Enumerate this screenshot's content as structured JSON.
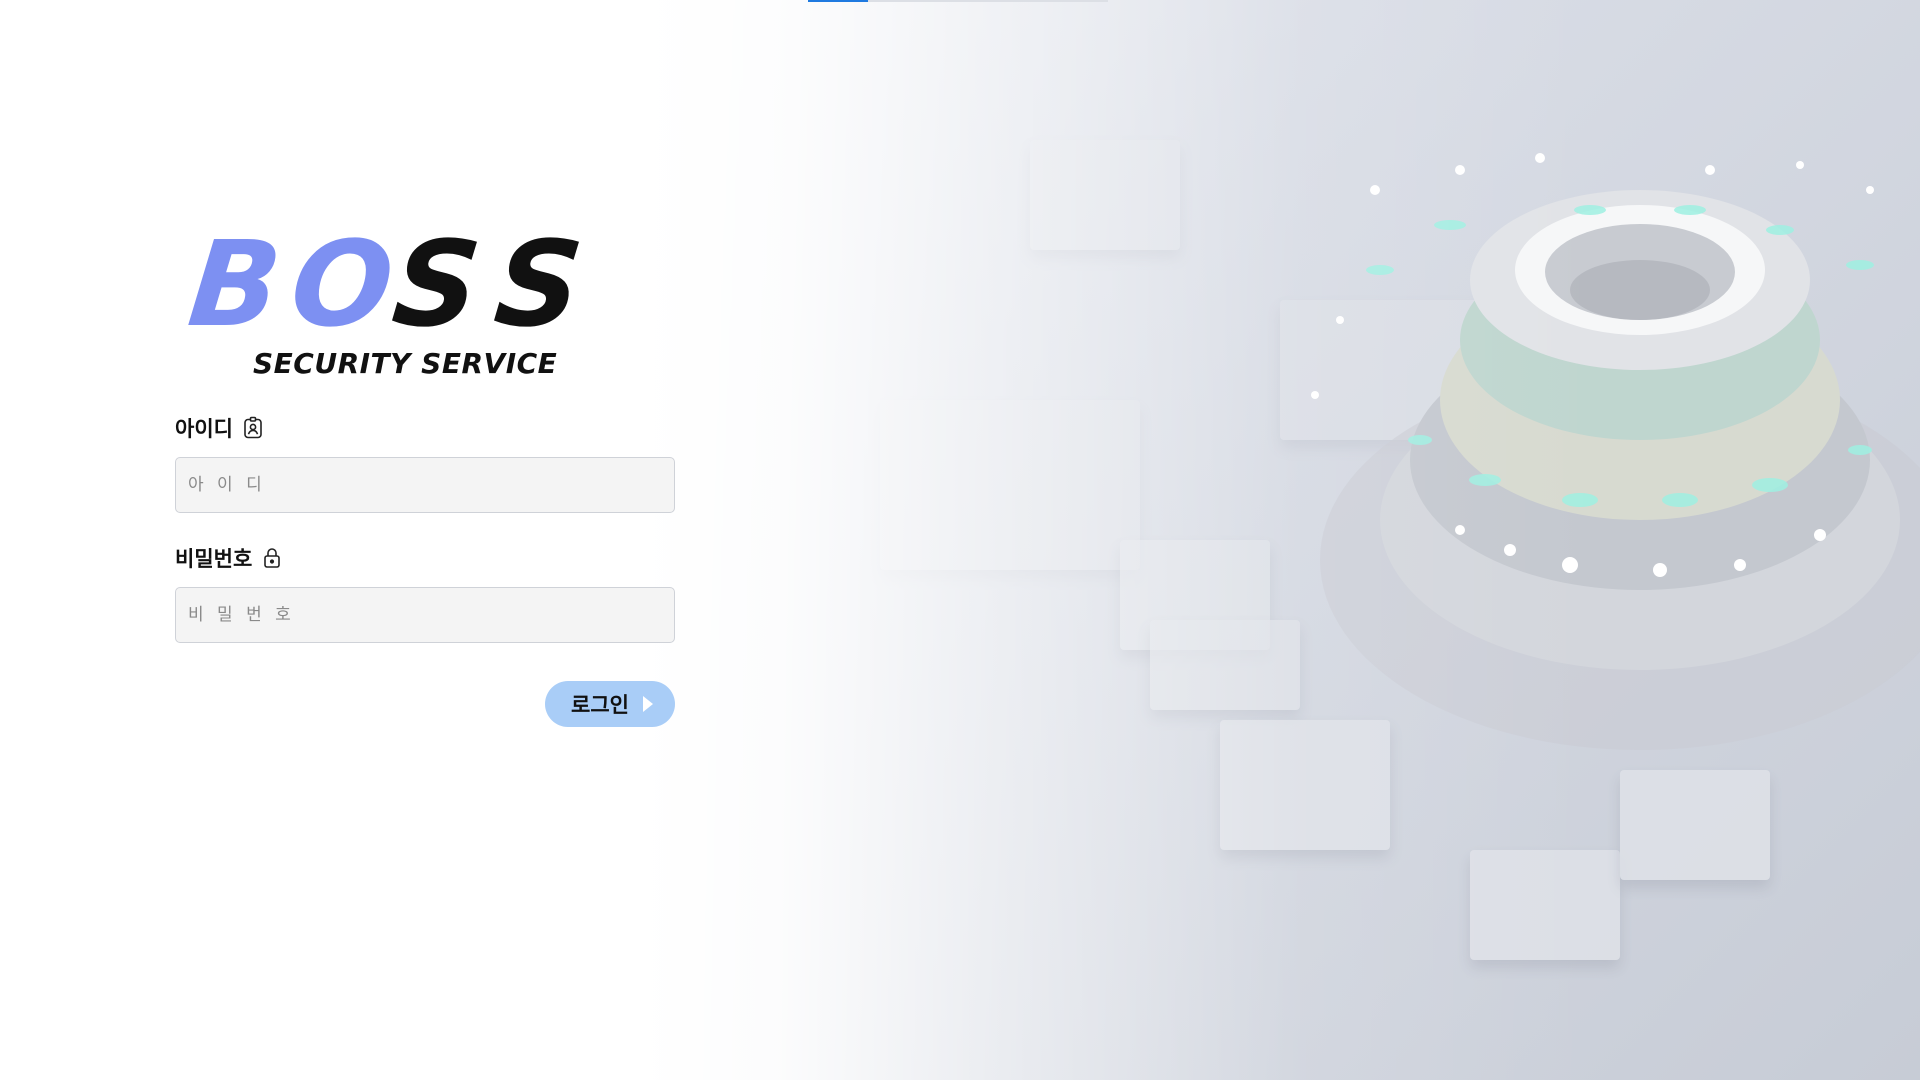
{
  "logo": {
    "letters": [
      "B",
      "O",
      "S",
      "S"
    ],
    "subtitle": "SECURITY SERVICE",
    "colors": {
      "accent": "#7d90f2",
      "dark": "#111111"
    }
  },
  "form": {
    "id_label": "아이디",
    "id_icon": "id-badge-icon",
    "id_placeholder": "아 이 디",
    "pw_label": "비밀번호",
    "pw_icon": "lock-icon",
    "pw_placeholder": "비 밀 번 호",
    "login_label": "로그인",
    "login_icon": "chevron-right-icon",
    "button_color": "#a9cdf7"
  }
}
